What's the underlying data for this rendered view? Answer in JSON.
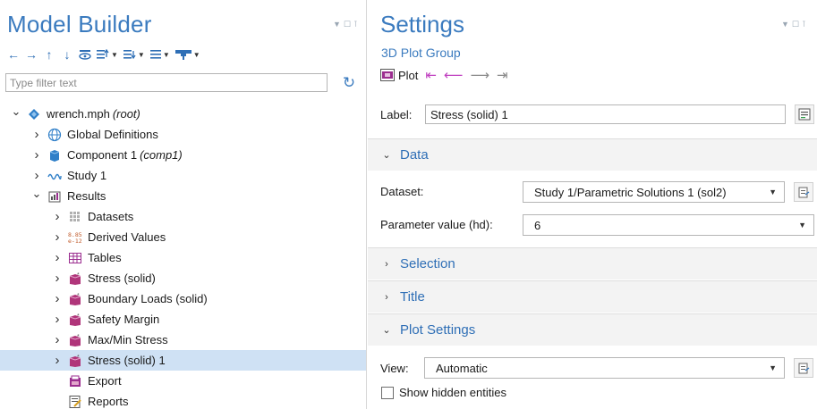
{
  "model_builder": {
    "title": "Model Builder",
    "filter_placeholder": "Type filter text",
    "tree": [
      {
        "label": "wrench.mph",
        "tag": "(root)",
        "level": 0,
        "caret": "open",
        "icon": "model-icon"
      },
      {
        "label": "Global Definitions",
        "tag": "",
        "level": 1,
        "caret": "closed",
        "icon": "globe-icon"
      },
      {
        "label": "Component 1",
        "tag": "(comp1)",
        "level": 1,
        "caret": "closed",
        "icon": "component-icon"
      },
      {
        "label": "Study 1",
        "tag": "",
        "level": 1,
        "caret": "closed",
        "icon": "study-icon"
      },
      {
        "label": "Results",
        "tag": "",
        "level": 1,
        "caret": "open",
        "icon": "results-icon"
      },
      {
        "label": "Datasets",
        "tag": "",
        "level": 2,
        "caret": "closed",
        "icon": "datasets-icon"
      },
      {
        "label": "Derived Values",
        "tag": "",
        "level": 2,
        "caret": "closed",
        "icon": "derived-values-icon"
      },
      {
        "label": "Tables",
        "tag": "",
        "level": 2,
        "caret": "closed",
        "icon": "table-icon"
      },
      {
        "label": "Stress (solid)",
        "tag": "",
        "level": 2,
        "caret": "closed",
        "icon": "plot-group-icon"
      },
      {
        "label": "Boundary Loads (solid)",
        "tag": "",
        "level": 2,
        "caret": "closed",
        "icon": "plot-group-icon"
      },
      {
        "label": "Safety Margin",
        "tag": "",
        "level": 2,
        "caret": "closed",
        "icon": "plot-group-icon"
      },
      {
        "label": "Max/Min Stress",
        "tag": "",
        "level": 2,
        "caret": "closed",
        "icon": "plot-group-icon"
      },
      {
        "label": "Stress (solid) 1",
        "tag": "",
        "level": 2,
        "caret": "closed",
        "icon": "plot-group-icon",
        "selected": true
      },
      {
        "label": "Export",
        "tag": "",
        "level": 2,
        "caret": "none",
        "icon": "export-icon"
      },
      {
        "label": "Reports",
        "tag": "",
        "level": 2,
        "caret": "none",
        "icon": "reports-icon"
      }
    ]
  },
  "settings": {
    "title": "Settings",
    "subtitle": "3D Plot Group",
    "plot_label": "Plot",
    "label_caption": "Label:",
    "label_value": "Stress (solid) 1",
    "sections": {
      "data": "Data",
      "selection": "Selection",
      "title": "Title",
      "plot_settings": "Plot Settings"
    },
    "dataset_caption": "Dataset:",
    "dataset_value": "Study 1/Parametric Solutions 1 (sol2)",
    "parameter_caption": "Parameter value (hd):",
    "parameter_value": "6",
    "view_caption": "View:",
    "view_value": "Automatic",
    "show_hidden_label": "Show hidden entities"
  },
  "colors": {
    "accent": "#3b7bbf",
    "selection": "#cfe1f4",
    "plot_nav": "#c040c0"
  }
}
